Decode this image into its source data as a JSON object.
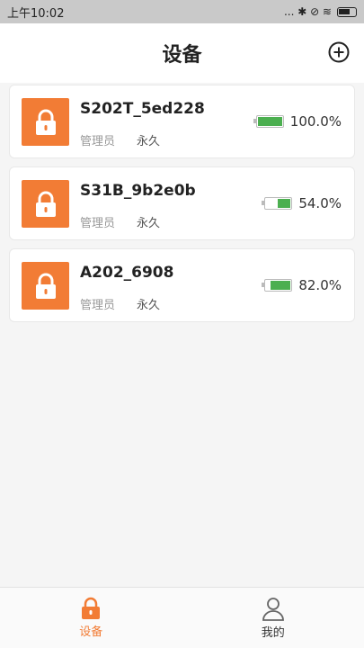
{
  "status_bar": {
    "time": "上午10:02",
    "icons_text": "... ✱ ⊘ ≋"
  },
  "header": {
    "title": "设备"
  },
  "devices": [
    {
      "name": "S202T_5ed228",
      "role": "管理员",
      "period": "永久",
      "battery_text": "100.0%",
      "battery_level": 1.0
    },
    {
      "name": "S31B_9b2e0b",
      "role": "管理员",
      "period": "永久",
      "battery_text": "54.0%",
      "battery_level": 0.54
    },
    {
      "name": "A202_6908",
      "role": "管理员",
      "period": "永久",
      "battery_text": "82.0%",
      "battery_level": 0.82
    }
  ],
  "tabbar": {
    "devices_label": "设备",
    "mine_label": "我的"
  },
  "colors": {
    "accent": "#f27c35",
    "battery": "#4caf50"
  }
}
